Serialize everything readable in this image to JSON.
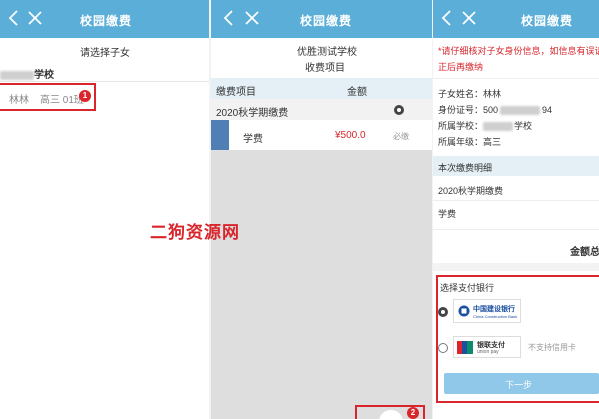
{
  "colors": {
    "header": "#5aaed8",
    "accent_red": "#d9262c",
    "price_red": "#d9262c",
    "section_bg": "#e4eff6"
  },
  "panel1": {
    "header_title": "校园缴费",
    "prompt": "请选择子女",
    "school_suffix": "学校",
    "child_name": "林林",
    "child_class": "高三 01班",
    "badge": "1"
  },
  "panel2": {
    "header_title": "校园缴费",
    "school": "优胜测试学校",
    "subtitle": "收费项目",
    "table_headers": {
      "item": "缴费项目",
      "amount": "金额"
    },
    "group_name": "2020秋学期缴费",
    "fee_row": {
      "name": "学费",
      "amount": "¥500.0",
      "tag": "必缴"
    },
    "badge": "2"
  },
  "panel3": {
    "header_title": "校园缴费",
    "warning": "*请仔细核对子女身份信息，如信息有误请联系学校修正后再缴纳",
    "warning_line1": "*请仔细核对子女身份信息，如信息有误请联",
    "warning_line2": "正后再缴纳",
    "info": {
      "name_label": "子女姓名：",
      "name_value": "林林",
      "id_label": "身份证号：",
      "id_prefix": "500",
      "id_suffix": "94",
      "school_label": "所属学校：",
      "school_suffix": "学校",
      "grade_label": "所属年级：",
      "grade_value": "高三"
    },
    "detail_title": "本次缴费明细",
    "detail_group": "2020秋学期缴费",
    "detail_item": "学费",
    "total_label": "金额总",
    "bank_section_title": "选择支付银行",
    "bank_ccb_name": "中国建设银行",
    "bank_ccb_sub": "China Construction Bank",
    "bank_unionpay_name": "银联支付",
    "bank_unionpay_sub": "union pay",
    "unionpay_note": "不支持信用卡",
    "next_button": "下一步"
  },
  "watermark": "二狗资源网"
}
